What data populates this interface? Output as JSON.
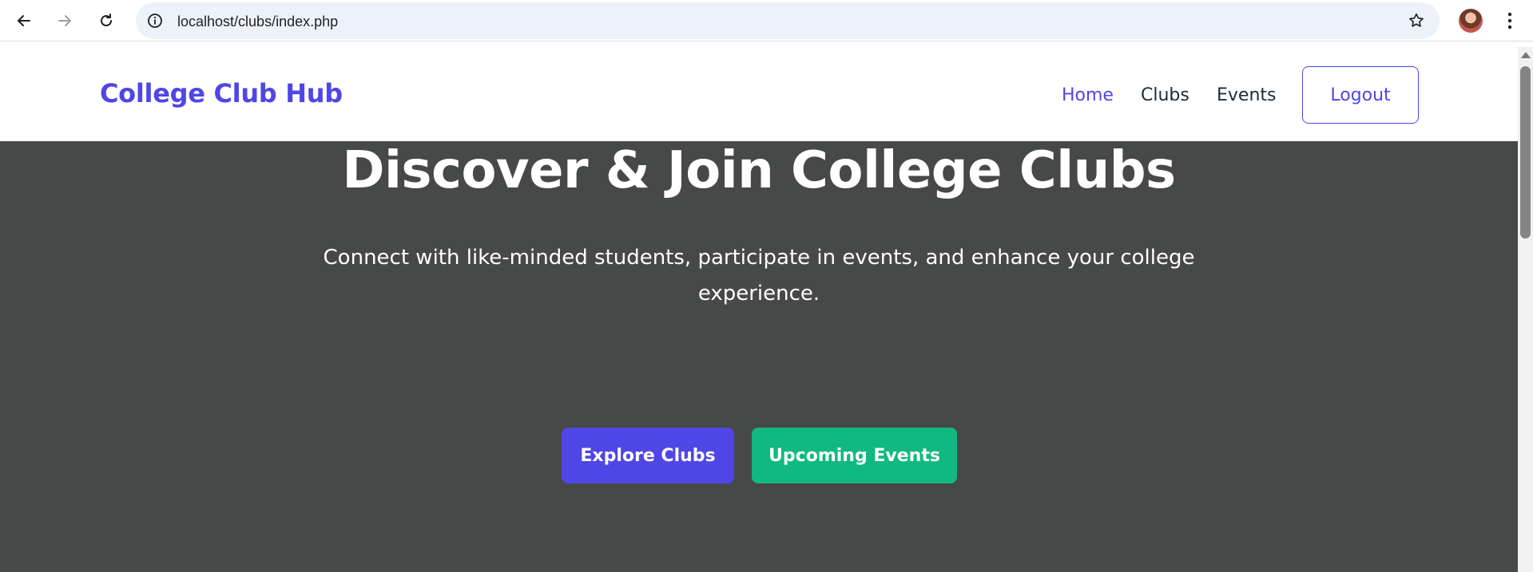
{
  "browser": {
    "url": "localhost/clubs/index.php"
  },
  "site": {
    "brand": "College Club Hub",
    "nav": {
      "home": "Home",
      "clubs": "Clubs",
      "events": "Events",
      "logout": "Logout"
    }
  },
  "hero": {
    "title": "Discover & Join College Clubs",
    "subtitle": "Connect with like-minded students, participate in events, and enhance your college experience.",
    "primary_button": "Explore Clubs",
    "secondary_button": "Upcoming Events"
  },
  "colors": {
    "brand": "#4f46e5",
    "hero_bg": "#474848",
    "secondary_button": "#10b981",
    "nav_text": "#1f2937"
  },
  "icons": [
    "back-icon",
    "forward-icon",
    "reload-icon",
    "info-icon",
    "star-icon",
    "profile-avatar",
    "more-menu-icon"
  ]
}
